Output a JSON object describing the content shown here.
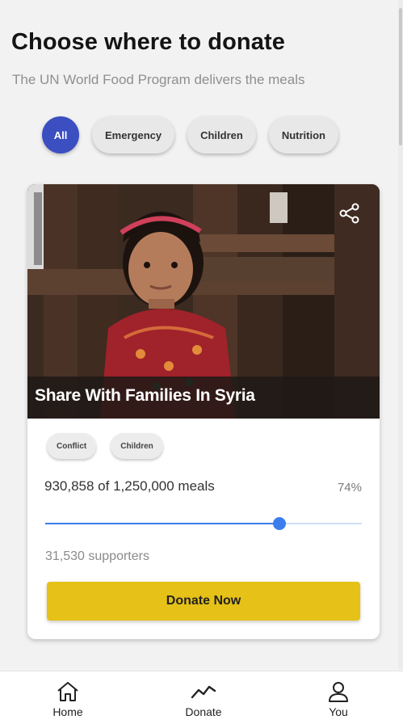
{
  "header": {
    "title": "Choose where to donate",
    "subtitle": "The UN World Food Program delivers the meals"
  },
  "filters": [
    {
      "label": "All",
      "active": true
    },
    {
      "label": "Emergency",
      "active": false
    },
    {
      "label": "Children",
      "active": false
    },
    {
      "label": "Nutrition",
      "active": false
    }
  ],
  "campaign": {
    "title": "Share With Families In Syria",
    "tags": [
      "Conflict",
      "Children"
    ],
    "meals_text": "930,858 of 1,250,000 meals",
    "meals_raised": 930858,
    "meals_goal": 1250000,
    "percent_label": "74%",
    "progress_fraction": 0.74,
    "supporters": "31,530 supporters",
    "donate_label": "Donate Now",
    "share_icon": "share-icon"
  },
  "nav": {
    "items": [
      {
        "label": "Home",
        "icon": "home-icon"
      },
      {
        "label": "Donate",
        "icon": "trend-chart-icon"
      },
      {
        "label": "You",
        "icon": "person-icon"
      }
    ]
  },
  "colors": {
    "accent": "#3b4fc1",
    "progress": "#3b7ded",
    "donate_button": "#e6c117"
  }
}
